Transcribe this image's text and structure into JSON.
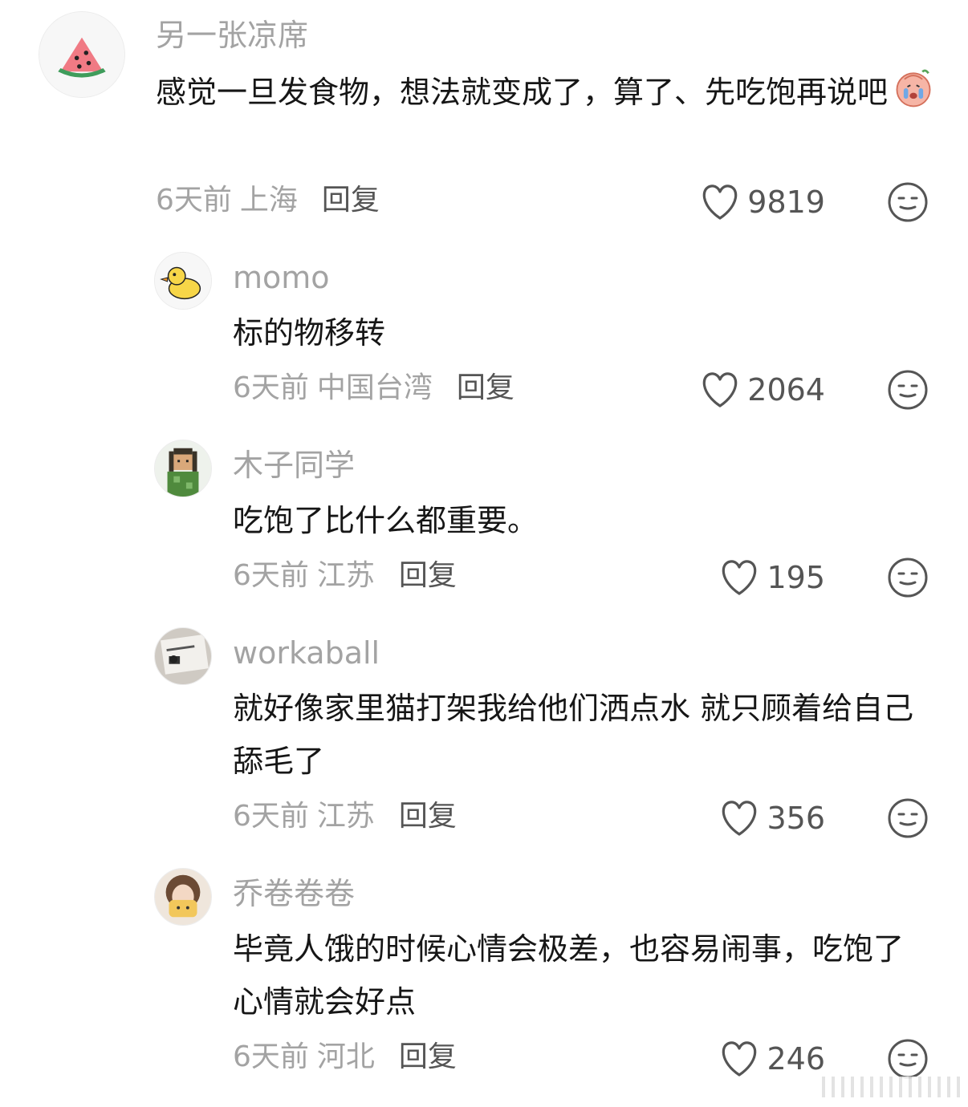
{
  "comments": [
    {
      "username": "另一张凉席",
      "avatar_icon": "watermelon-icon",
      "text": "感觉一旦发食物，想法就变成了，算了、先吃饱再说吧",
      "inline_emoji": "crying-face-icon",
      "time": "6天前",
      "location": "上海",
      "reply": "回复",
      "likes": "9819"
    },
    {
      "username": "momo",
      "avatar_icon": "rubber-duck-icon",
      "text": "标的物移转",
      "time": "6天前",
      "location": "中国台湾",
      "reply": "回复",
      "likes": "2064"
    },
    {
      "username": "木子同学",
      "avatar_icon": "pixel-character-icon",
      "text": "吃饱了比什么都重要。",
      "time": "6天前",
      "location": "江苏",
      "reply": "回复",
      "likes": "195"
    },
    {
      "username": "workaball",
      "avatar_icon": "photo-avatar-icon",
      "text": "就好像家里猫打架我给他们洒点水 就只顾着给自己舔毛了",
      "time": "6天前",
      "location": "江苏",
      "reply": "回复",
      "likes": "356"
    },
    {
      "username": "乔卷卷卷",
      "avatar_icon": "girl-photo-avatar-icon",
      "text": "毕竟人饿的时候心情会极差，也容易闹事，吃饱了心情就会好点",
      "time": "6天前",
      "location": "河北",
      "reply": "回复",
      "likes": "246"
    }
  ],
  "colors": {
    "username": "#a3a3a3",
    "text": "#161616",
    "meta": "#a3a3a3",
    "action": "#555555"
  }
}
